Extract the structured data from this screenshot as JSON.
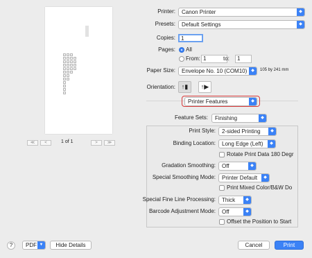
{
  "preview": {
    "page_indicator": "1 of 1",
    "first": "≪",
    "prev": "<",
    "next": ">",
    "last": "≫"
  },
  "printer": {
    "label": "Printer:",
    "value": "Canon Printer"
  },
  "presets": {
    "label": "Presets:",
    "value": "Default Settings"
  },
  "copies": {
    "label": "Copies:",
    "value": "1"
  },
  "pages": {
    "label": "Pages:",
    "all": "All",
    "from": "From:",
    "from_value": "1",
    "to": "to:",
    "to_value": "1"
  },
  "paper_size": {
    "label": "Paper Size:",
    "value": "Envelope No. 10 (COM10)",
    "dimensions": "105 by 241 mm"
  },
  "orientation": {
    "label": "Orientation:",
    "portrait_icon": "portrait-icon",
    "landscape_icon": "landscape-icon"
  },
  "section": {
    "value": "Printer Features"
  },
  "feature_sets": {
    "label": "Feature Sets:",
    "value": "Finishing"
  },
  "settings": {
    "print_style": {
      "label": "Print Style:",
      "value": "2-sided Printing"
    },
    "binding_location": {
      "label": "Binding Location:",
      "value": "Long Edge (Left)"
    },
    "rotate": "Rotate Print Data 180 Degr",
    "gradation": {
      "label": "Gradation Smoothing:",
      "value": "Off"
    },
    "special_smoothing": {
      "label": "Special Smoothing Mode:",
      "value": "Printer Default"
    },
    "print_mixed": "Print Mixed Color/B&W Do",
    "fine_line": {
      "label": "Special Fine Line Processing:",
      "value": "Thick"
    },
    "barcode": {
      "label": "Barcode Adjustment Mode:",
      "value": "Off"
    },
    "offset": "Offset the Position to Start"
  },
  "footer": {
    "help": "?",
    "pdf": "PDF",
    "hide_details": "Hide Details",
    "cancel": "Cancel",
    "print": "Print"
  },
  "colors": {
    "accent": "#3b82f6",
    "highlight": "#d83a3a"
  }
}
